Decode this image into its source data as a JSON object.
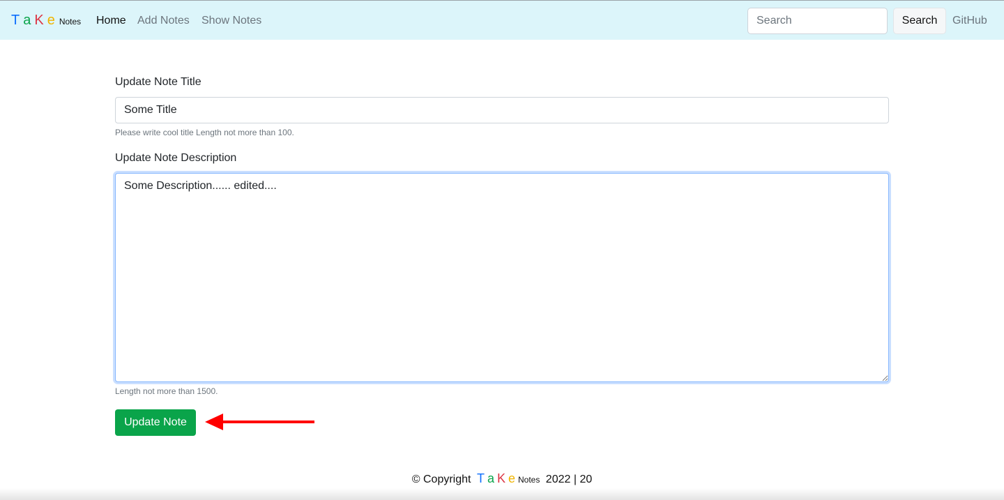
{
  "navbar": {
    "brand": {
      "letters": [
        "T",
        "a",
        "K",
        "e"
      ],
      "letter_colors": [
        "#0d6efd",
        "#0aa44a",
        "#dc3545",
        "#f0b400"
      ],
      "suffix": "Notes"
    },
    "links": [
      {
        "label": "Home",
        "active": true
      },
      {
        "label": "Add Notes",
        "active": false
      },
      {
        "label": "Show Notes",
        "active": false
      }
    ],
    "search": {
      "placeholder": "Search",
      "button_label": "Search"
    },
    "github_label": "GitHub"
  },
  "form": {
    "title_label": "Update Note Title",
    "title_value": "Some Title",
    "title_help": "Please write cool title Length not more than 100.",
    "description_label": "Update Note Description",
    "description_value": "Some Description...... edited....",
    "description_help": "Length not more than 1500.",
    "submit_label": "Update Note"
  },
  "annotation": {
    "arrow_color": "#ff0000"
  },
  "footer": {
    "prefix": "© Copyright",
    "suffix": "2022 | 20"
  }
}
